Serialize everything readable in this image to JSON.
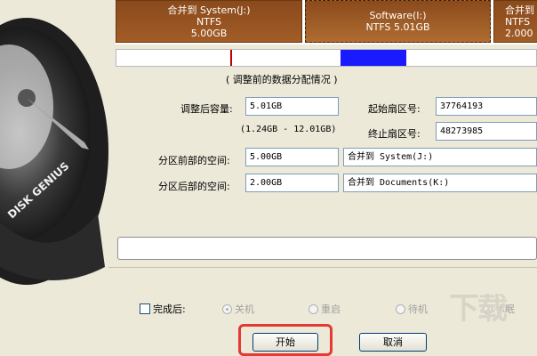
{
  "partitions": [
    {
      "name": "合并到 System(J:)",
      "fs": "NTFS",
      "size": "5.00GB"
    },
    {
      "name": "Software(I:)",
      "fs": "NTFS 5.01GB",
      "size": ""
    },
    {
      "name": "合并到 Docum",
      "fs": "NTFS",
      "size": "2.000"
    }
  ],
  "art_text": "DISK GENIUS",
  "section_title": "( 调整前的数据分配情况 )",
  "form": {
    "size_after_label": "调整后容量:",
    "size_after_value": "5.01GB",
    "range_text": "(1.24GB - 12.01GB)",
    "start_sector_label": "起始扇区号:",
    "start_sector_value": "37764193",
    "end_sector_label": "终止扇区号:",
    "end_sector_value": "48273985",
    "front_space_label": "分区前部的空间:",
    "front_space_value": "5.00GB",
    "front_space_target": "合并到 System(J:)",
    "back_space_label": "分区后部的空间:",
    "back_space_value": "2.00GB",
    "back_space_target": "合并到 Documents(K:)"
  },
  "after_done": {
    "label": "完成后:",
    "options": [
      "关机",
      "重启",
      "待机",
      "休眠"
    ]
  },
  "buttons": {
    "start": "开始",
    "cancel": "取消"
  },
  "watermark": "下载"
}
